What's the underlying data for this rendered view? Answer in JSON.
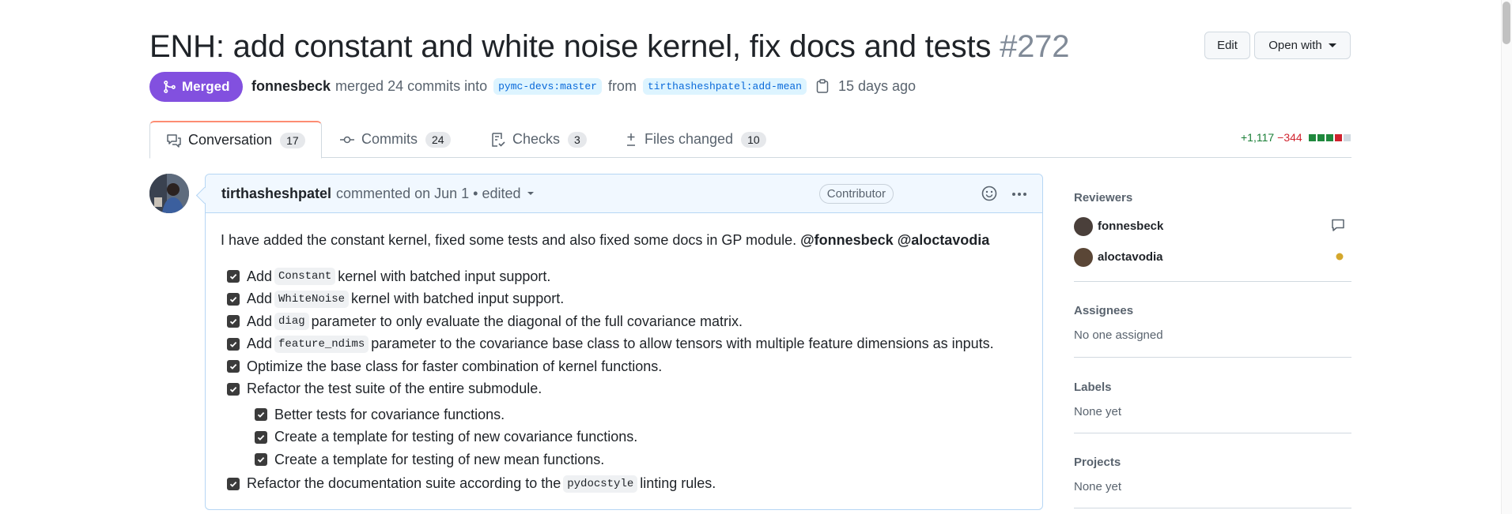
{
  "pr": {
    "title": "ENH: add constant and white noise kernel, fix docs and tests",
    "number": "#272",
    "state": "Merged",
    "author": "fonnesbeck",
    "merge_text": "merged 24 commits into",
    "base_branch": "pymc-devs:master",
    "from_text": "from",
    "head_branch": "tirthasheshpatel:add-mean",
    "time": "15 days ago",
    "colors": {
      "merged": "#8250df",
      "accent_tab": "#fd8c73"
    }
  },
  "header_actions": {
    "edit_label": "Edit",
    "open_with_label": "Open with"
  },
  "tabs": [
    {
      "label": "Conversation",
      "count": "17",
      "icon": "comment-discussion-icon"
    },
    {
      "label": "Commits",
      "count": "24",
      "icon": "git-commit-icon"
    },
    {
      "label": "Checks",
      "count": "3",
      "icon": "checklist-icon"
    },
    {
      "label": "Files changed",
      "count": "10",
      "icon": "file-diff-icon"
    }
  ],
  "diffstat": {
    "additions": "+1,117",
    "deletions": "−344",
    "blocks": [
      "green",
      "green",
      "green",
      "red",
      "gray"
    ]
  },
  "comment": {
    "author": "tirthasheshpatel",
    "action": "commented on Jun 1 • edited",
    "role": "Contributor",
    "intro": "I have added the constant kernel, fixed some tests and also fixed some docs in GP module.",
    "mentions": [
      "@fonnesbeck",
      "@aloctavodia"
    ],
    "tasks": [
      {
        "pre": "Add",
        "code": "Constant",
        "post": "kernel with batched input support."
      },
      {
        "pre": "Add",
        "code": "WhiteNoise",
        "post": "kernel with batched input support."
      },
      {
        "pre": "Add",
        "code": "diag",
        "post": "parameter to only evaluate the diagonal of the full covariance matrix."
      },
      {
        "pre": "Add",
        "code": "feature_ndims",
        "post": "parameter to the covariance base class to allow tensors with multiple feature dimensions as inputs."
      },
      {
        "text": "Optimize the base class for faster combination of kernel functions."
      },
      {
        "text": "Refactor the test suite of the entire submodule."
      }
    ],
    "subtasks": [
      {
        "text": "Better tests for covariance functions."
      },
      {
        "text": "Create a template for testing of new covariance functions."
      },
      {
        "text": "Create a template for testing of new mean functions."
      }
    ],
    "last_task": {
      "pre": "Refactor the documentation suite according to the",
      "code": "pydocstyle",
      "post": "linting rules."
    }
  },
  "sidebar": {
    "reviewers_title": "Reviewers",
    "reviewers": [
      {
        "name": "fonnesbeck",
        "status": "commented-icon"
      },
      {
        "name": "aloctavodia",
        "status": "pending-dot"
      }
    ],
    "assignees_title": "Assignees",
    "assignees_value": "No one assigned",
    "labels_title": "Labels",
    "labels_value": "None yet",
    "projects_title": "Projects",
    "projects_value": "None yet"
  }
}
